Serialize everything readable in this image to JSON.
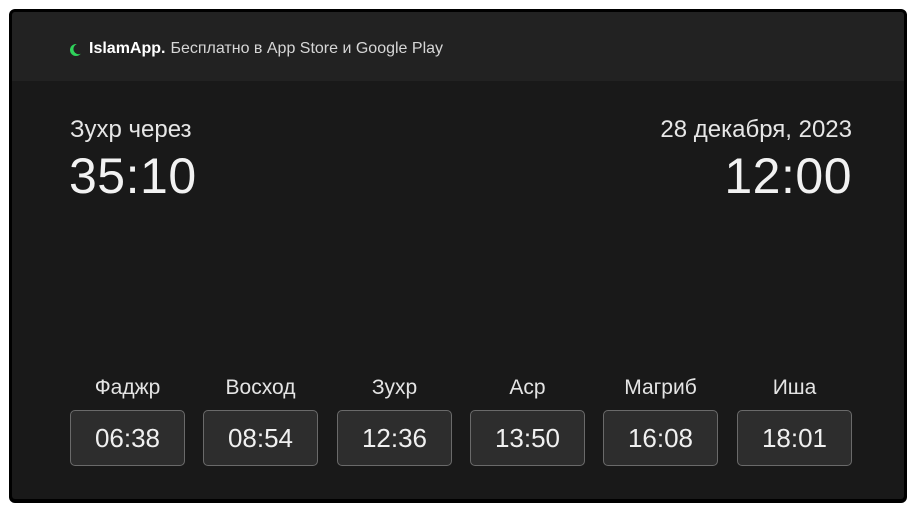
{
  "banner": {
    "brand": "IslamApp.",
    "tagline": "Бесплатно в App Store и Google Play",
    "icon": "crescent-moon-icon",
    "accent_color": "#2fd35b"
  },
  "countdown": {
    "label": "Зухр через",
    "value": "35:10"
  },
  "datetime": {
    "date": "28 декабря, 2023",
    "time": "12:00"
  },
  "prayers": [
    {
      "name": "Фаджр",
      "time": "06:38"
    },
    {
      "name": "Восход",
      "time": "08:54"
    },
    {
      "name": "Зухр",
      "time": "12:36"
    },
    {
      "name": "Аср",
      "time": "13:50"
    },
    {
      "name": "Магриб",
      "time": "16:08"
    },
    {
      "name": "Иша",
      "time": "18:01"
    }
  ],
  "colors": {
    "background": "#191919",
    "banner_background": "#222222",
    "box_background": "#2d2d2d",
    "box_border": "#6a6a6a"
  }
}
